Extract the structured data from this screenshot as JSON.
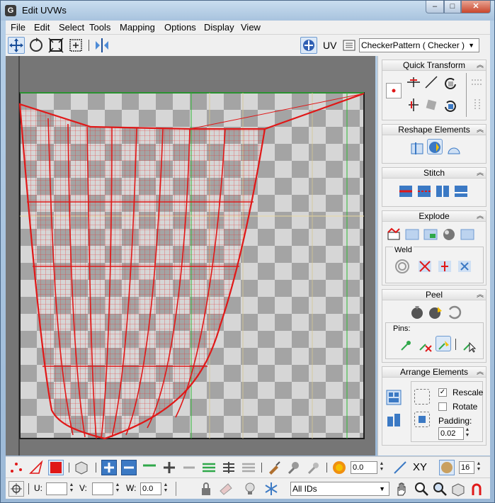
{
  "window": {
    "title": "Edit UVWs",
    "controls": [
      "–",
      "□",
      "✕"
    ]
  },
  "menu": [
    "File",
    "Edit",
    "Select",
    "Tools",
    "Mapping",
    "Options",
    "Display",
    "View"
  ],
  "toolbar": {
    "uv_label": "UV",
    "map_select": "CheckerPattern  ( Checker )"
  },
  "panels": {
    "quick_transform": "Quick Transform",
    "reshape": "Reshape Elements",
    "stitch": "Stitch",
    "explode": "Explode",
    "weld": "Weld",
    "peel": "Peel",
    "pins": "Pins:",
    "arrange": "Arrange Elements",
    "rescale": "Rescale",
    "rotate": "Rotate",
    "padding_label": "Padding:",
    "padding_value": "0.02",
    "rescale_checked": true,
    "rotate_checked": false
  },
  "bottom": {
    "spin_value": "0.0",
    "xy_label": "XY",
    "grid_value": "16",
    "u_label": "U:",
    "v_label": "V:",
    "w_label": "W:",
    "w_value": "0.0",
    "ids_select": "All IDs"
  },
  "colors": {
    "accent": "#e02020",
    "bluebtn": "#3b79c4",
    "green": "#2fa84a"
  }
}
